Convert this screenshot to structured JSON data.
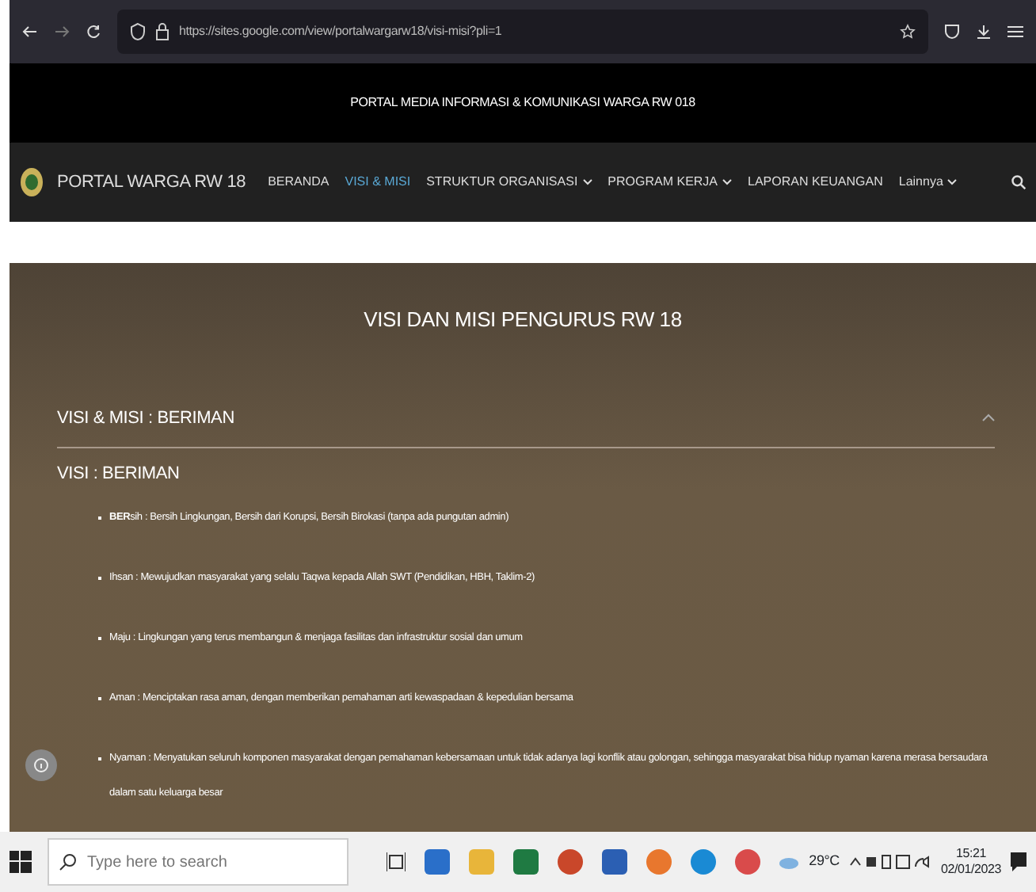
{
  "browser": {
    "url": "https://sites.google.com/view/portalwargarw18/visi-misi?pli=1"
  },
  "banner": {
    "text": "PORTAL MEDIA INFORMASI & KOMUNIKASI WARGA RW 018"
  },
  "site_nav": {
    "title": "PORTAL WARGA RW 18",
    "items": [
      {
        "label": "BERANDA",
        "selected": false,
        "dropdown": false
      },
      {
        "label": "VISI & MISI",
        "selected": true,
        "dropdown": false
      },
      {
        "label": "STRUKTUR ORGANISASI",
        "selected": false,
        "dropdown": true
      },
      {
        "label": "PROGRAM KERJA",
        "selected": false,
        "dropdown": true
      },
      {
        "label": "LAPORAN KEUANGAN",
        "selected": false,
        "dropdown": false
      },
      {
        "label": "Lainnya",
        "selected": false,
        "dropdown": true
      }
    ]
  },
  "hero": {
    "title": "VISI DAN MISI  PENGURUS RW 18"
  },
  "accordion": {
    "title": "VISI & MISI : BERIMAN",
    "expanded": true,
    "heading": "VISI : BERIMAN",
    "items": [
      "**BER**sih : Bersih Lingkungan, Bersih dari Korupsi, Bersih Birokasi (tanpa ada pungutan admin)",
      "Ihsan : Mewujudkan masyarakat yang selalu Taqwa kepada Allah SWT (Pendidikan, HBH, Taklim-2)",
      "Maju : Lingkungan yang terus membangun & menjaga fasilitas dan infrastruktur sosial dan umum",
      "Aman : Menciptakan rasa aman, dengan memberikan pemahaman arti kewaspadaan & kepedulian bersama",
      "Nyaman : Menyatukan seluruh komponen masyarakat dengan pemahaman kebersamaan untuk tidak adanya lagi konflik atau golongan, sehingga masyarakat bisa hidup nyaman karena merasa bersaudara dalam satu keluarga besar"
    ]
  },
  "taskbar": {
    "search_placeholder": "Type here to search",
    "weather": "29°C",
    "time": "15:21",
    "date": "02/01/2023"
  }
}
